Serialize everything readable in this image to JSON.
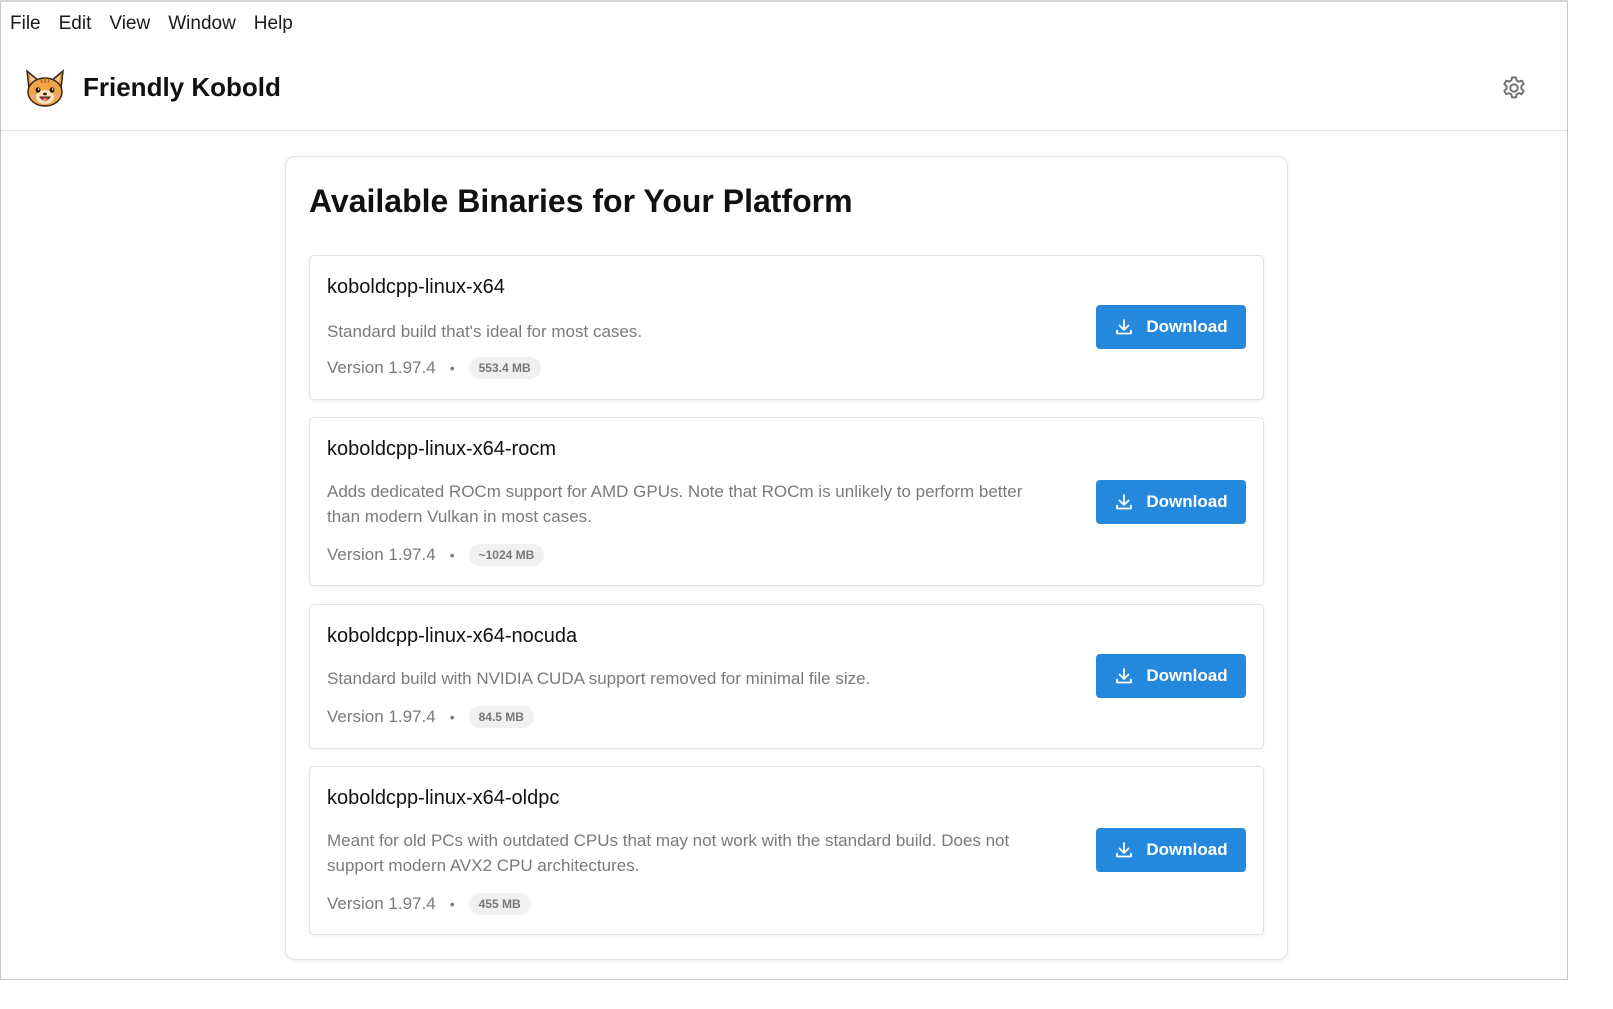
{
  "menubar": {
    "items": [
      "File",
      "Edit",
      "View",
      "Window",
      "Help"
    ]
  },
  "header": {
    "title": "Friendly Kobold",
    "logo_icon": "kobold-cat-logo",
    "settings_icon": "gear-icon"
  },
  "panel": {
    "title": "Available Binaries for Your Platform",
    "binaries": [
      {
        "name": "koboldcpp-linux-x64",
        "description": "Standard build that's ideal for most cases.",
        "version": "Version 1.97.4",
        "separator": "•",
        "size": "553.4 MB",
        "download_label": "Download"
      },
      {
        "name": "koboldcpp-linux-x64-rocm",
        "description": "Adds dedicated ROCm support for AMD GPUs. Note that ROCm is unlikely to perform better than modern Vulkan in most cases.",
        "version": "Version 1.97.4",
        "separator": "•",
        "size": "~1024 MB",
        "download_label": "Download"
      },
      {
        "name": "koboldcpp-linux-x64-nocuda",
        "description": "Standard build with NVIDIA CUDA support removed for minimal file size.",
        "version": "Version 1.97.4",
        "separator": "•",
        "size": "84.5 MB",
        "download_label": "Download"
      },
      {
        "name": "koboldcpp-linux-x64-oldpc",
        "description": "Meant for old PCs with outdated CPUs that may not work with the standard build. Does not support modern AVX2 CPU architectures.",
        "version": "Version 1.97.4",
        "separator": "•",
        "size": "455 MB",
        "download_label": "Download"
      }
    ]
  },
  "colors": {
    "accent": "#2489dd",
    "muted_text": "#7a7a7a",
    "badge_bg": "#f0f0f0"
  }
}
